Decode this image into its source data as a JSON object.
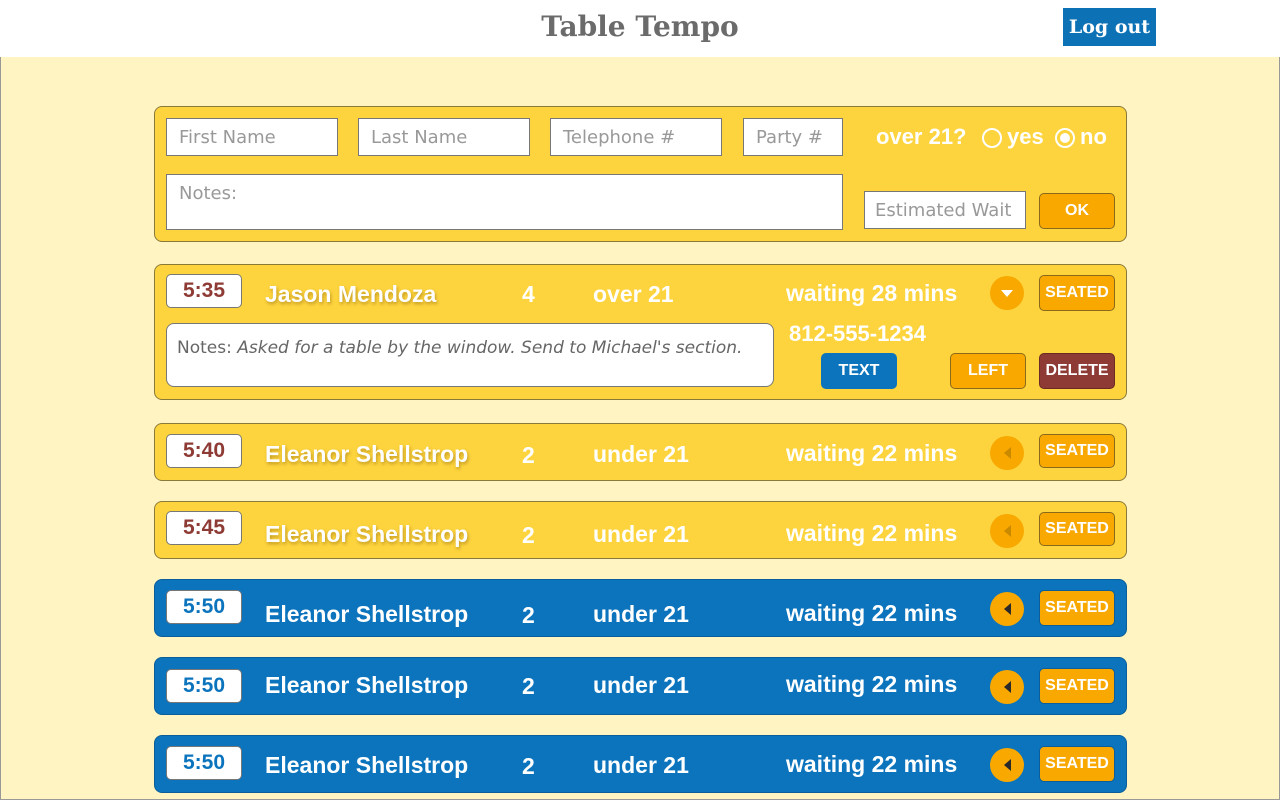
{
  "header": {
    "title": "Table Tempo",
    "logout_label": "Log out"
  },
  "form": {
    "first_name_placeholder": "First Name",
    "last_name_placeholder": "Last Name",
    "telephone_placeholder": "Telephone #",
    "party_placeholder": "Party #",
    "notes_placeholder": "Notes:",
    "estimated_wait_placeholder": "Estimated Wait",
    "over21_label": "over 21?",
    "yes_label": "yes",
    "no_label": "no",
    "selected_option": "no",
    "ok_label": "OK"
  },
  "expanded": {
    "time": "5:35",
    "name": "Jason Mendoza",
    "party": "4",
    "age": "over 21",
    "wait": "waiting 28 mins",
    "phone": "812-555-1234",
    "notes_label": "Notes:",
    "notes_text": "Asked for a table by the window. Send to Michael's section.",
    "text_label": "TEXT",
    "left_label": "LEFT",
    "delete_label": "DELETE",
    "seated_label": "SEATED"
  },
  "rows": [
    {
      "time": "5:40",
      "name": "Eleanor Shellstrop",
      "party": "2",
      "age": "under 21",
      "wait": "waiting 22 mins",
      "seated_label": "SEATED",
      "style": "yellow"
    },
    {
      "time": "5:45",
      "name": "Eleanor Shellstrop",
      "party": "2",
      "age": "under 21",
      "wait": "waiting 22 mins",
      "seated_label": "SEATED",
      "style": "yellow"
    },
    {
      "time": "5:50",
      "name": "Eleanor Shellstrop",
      "party": "2",
      "age": "under 21",
      "wait": "waiting 22 mins",
      "seated_label": "SEATED",
      "style": "blue"
    },
    {
      "time": "5:50",
      "name": "Eleanor Shellstrop",
      "party": "2",
      "age": "under 21",
      "wait": "waiting 22 mins",
      "seated_label": "SEATED",
      "style": "blue"
    },
    {
      "time": "5:50",
      "name": "Eleanor Shellstrop",
      "party": "2",
      "age": "under 21",
      "wait": "waiting 22 mins",
      "seated_label": "SEATED",
      "style": "blue"
    }
  ],
  "colors": {
    "accent_blue": "#0b74bd",
    "accent_yellow": "#fdd43d",
    "accent_orange": "#f9a800",
    "danger_red": "#8e3a35",
    "background": "#fff4c2"
  }
}
